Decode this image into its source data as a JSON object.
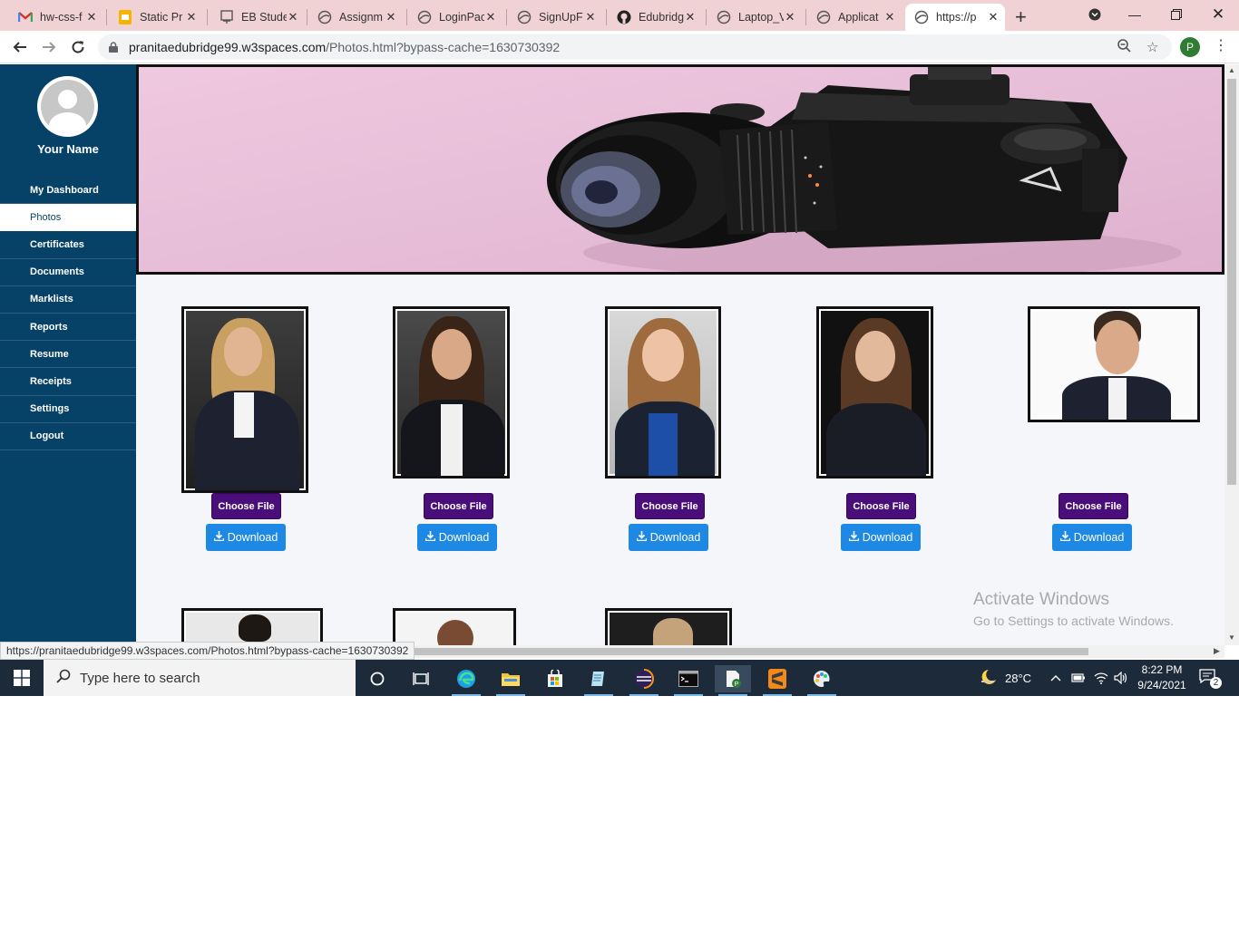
{
  "browser": {
    "tabs": [
      {
        "title": "hw-css-f",
        "icon": "gmail-icon"
      },
      {
        "title": "Static Pr",
        "icon": "slides-icon"
      },
      {
        "title": "EB Stude",
        "icon": "eb-icon"
      },
      {
        "title": "Assignm",
        "icon": "globe-icon"
      },
      {
        "title": "LoginPac",
        "icon": "globe-icon"
      },
      {
        "title": "SignUpF",
        "icon": "globe-icon"
      },
      {
        "title": "Edubridg",
        "icon": "github-icon"
      },
      {
        "title": "Laptop_V",
        "icon": "globe-icon"
      },
      {
        "title": "Applicat",
        "icon": "globe-icon"
      },
      {
        "title": "https://p",
        "icon": "globe-icon",
        "active": true
      }
    ],
    "url_host": "pranitaedubridge99.w3spaces.com",
    "url_path": "/Photos.html?bypass-cache=1630730392",
    "profile_initial": "P",
    "status_url": "https://pranitaedubridge99.w3spaces.com/Photos.html?bypass-cache=1630730392"
  },
  "sidebar": {
    "username": "Your Name",
    "items": [
      {
        "label": "My Dashboard",
        "active": false
      },
      {
        "label": "Photos",
        "active": true
      },
      {
        "label": "Certificates",
        "active": false
      },
      {
        "label": "Documents",
        "active": false
      },
      {
        "label": "Marklists",
        "active": false
      },
      {
        "label": "Reports",
        "active": false
      },
      {
        "label": "Resume",
        "active": false
      },
      {
        "label": "Receipts",
        "active": false
      },
      {
        "label": "Settings",
        "active": false
      },
      {
        "label": "Logout",
        "active": false
      }
    ]
  },
  "gallery": {
    "choose_label": "Choose File",
    "download_label": "Download"
  },
  "watermark": {
    "line1": "Activate Windows",
    "line2": "Go to Settings to activate Windows."
  },
  "taskbar": {
    "search_placeholder": "Type here to search",
    "temperature": "28°C",
    "time": "8:22 PM",
    "date": "9/24/2021",
    "notification_count": "2"
  },
  "colors": {
    "sidebar_bg": "#064268",
    "choose_btn": "#4a0e7a",
    "download_btn": "#1e88e5",
    "banner_bg": "#ecc6dc"
  }
}
